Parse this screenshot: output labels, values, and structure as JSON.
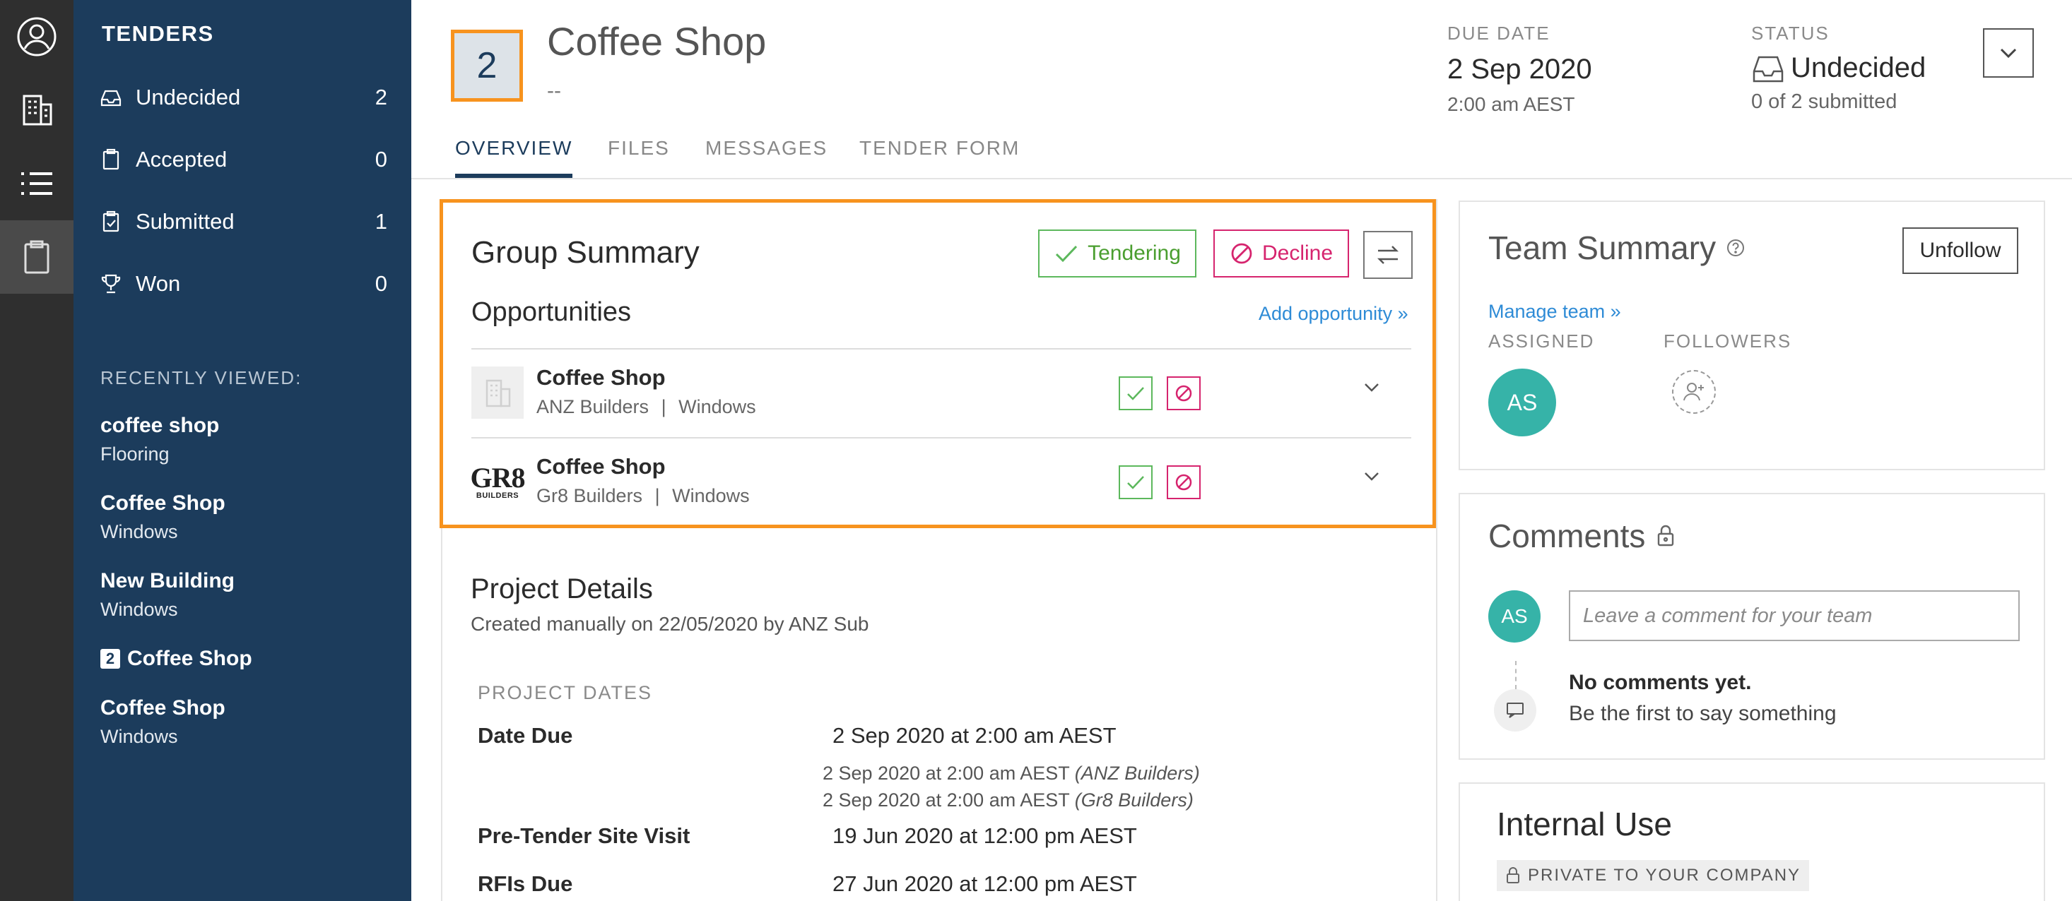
{
  "sidebar": {
    "title": "TENDERS",
    "items": [
      {
        "label": "Undecided",
        "count": "2"
      },
      {
        "label": "Accepted",
        "count": "0"
      },
      {
        "label": "Submitted",
        "count": "1"
      },
      {
        "label": "Won",
        "count": "0"
      }
    ],
    "recent_title": "RECENTLY VIEWED:",
    "recent": [
      {
        "name": "coffee shop",
        "sub": "Flooring"
      },
      {
        "name": "Coffee Shop",
        "sub": "Windows"
      },
      {
        "name": "New Building",
        "sub": "Windows"
      },
      {
        "badge": "2",
        "name": "Coffee Shop",
        "sub": ""
      },
      {
        "name": "Coffee Shop",
        "sub": "Windows"
      }
    ]
  },
  "header": {
    "count": "2",
    "title": "Coffee Shop",
    "subtitle": "--",
    "due_label": "DUE DATE",
    "due_date": "2 Sep 2020",
    "due_time": "2:00 am AEST",
    "status_label": "STATUS",
    "status_value": "Undecided",
    "status_sub": "0 of 2 submitted",
    "tabs": [
      "OVERVIEW",
      "FILES",
      "MESSAGES",
      "TENDER FORM"
    ]
  },
  "group_summary": {
    "title": "Group Summary",
    "tendering_label": "Tendering",
    "decline_label": "Decline",
    "opportunities_title": "Opportunities",
    "add_opportunity": "Add opportunity »",
    "rows": [
      {
        "name": "Coffee Shop",
        "builder": "ANZ Builders",
        "trade": "Windows"
      },
      {
        "name": "Coffee Shop",
        "builder": "Gr8 Builders",
        "trade": "Windows",
        "logo_text_top": "GR8",
        "logo_text_bottom": "BUILDERS"
      }
    ]
  },
  "project_details": {
    "title": "Project Details",
    "created": "Created manually on 22/05/2020 by ANZ Sub",
    "dates_label": "PROJECT DATES",
    "date_due_key": "Date Due",
    "date_due_val": "2 Sep 2020 at 2:00 am AEST",
    "date_due_anz": "2 Sep 2020 at 2:00 am AEST",
    "date_due_anz_who": "(ANZ Builders)",
    "date_due_gr8": "2 Sep 2020 at 2:00 am AEST",
    "date_due_gr8_who": "(Gr8 Builders)",
    "site_visit_key": "Pre-Tender Site Visit",
    "site_visit_val": "19 Jun 2020 at 12:00 pm AEST",
    "rfis_key": "RFIs Due",
    "rfis_val": "27 Jun 2020 at 12:00 pm AEST"
  },
  "team_summary": {
    "title": "Team Summary",
    "unfollow_label": "Unfollow",
    "manage_team": "Manage team »",
    "assigned_label": "ASSIGNED",
    "followers_label": "FOLLOWERS",
    "assigned_initials": "AS"
  },
  "comments": {
    "title": "Comments",
    "avatar_initials": "AS",
    "placeholder": "Leave a comment for your team",
    "empty_title": "No comments yet.",
    "empty_sub": "Be the first to say something"
  },
  "internal_use": {
    "title": "Internal Use",
    "private_label": "PRIVATE TO YOUR COMPANY"
  },
  "colors": {
    "sidebar_bg": "#1c3c5c",
    "rail_bg": "#2f2f2f",
    "highlight_orange": "#f7931e",
    "accept_green": "#5cb85c",
    "decline_pink": "#d6246e",
    "link_blue": "#2e8bd6",
    "avatar_teal": "#36b3a8"
  }
}
